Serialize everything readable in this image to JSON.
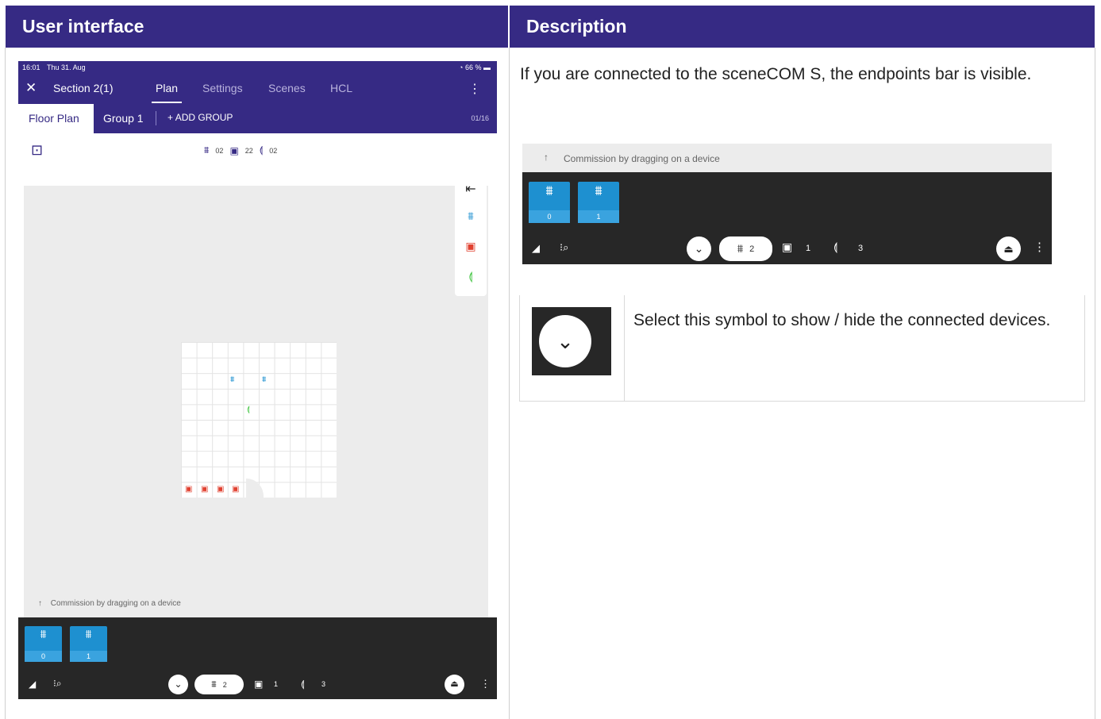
{
  "headers": {
    "left": "User interface",
    "right": "Description"
  },
  "tablet": {
    "status": {
      "time": "16:01",
      "date": "Thu 31. Aug",
      "battery": "66 %"
    },
    "appbar": {
      "close_icon": "close-icon",
      "section": "Section 2(1)",
      "tabs": [
        "Plan",
        "Settings",
        "Scenes",
        "HCL"
      ],
      "active_tab": "Plan"
    },
    "subbar": {
      "floor_plan": "Floor Plan",
      "group": "Group 1",
      "add_group": "ADD GROUP",
      "count": "01/16"
    },
    "counts": {
      "luminaires": "02",
      "sensors": "22",
      "switches": "02"
    },
    "commission_hint": "Commission by dragging on a device",
    "tiles": [
      "0",
      "1"
    ],
    "bottom_counts": {
      "luminaires": "2",
      "sensors": "1",
      "switches": "3"
    }
  },
  "right": {
    "description": "If you are connected to the sceneCOM S, the endpoints bar is visible.",
    "crop": {
      "commission_hint": "Commission by dragging on a device",
      "tiles": [
        "0",
        "1"
      ],
      "bottom_counts": {
        "luminaires": "2",
        "sensors": "1",
        "switches": "3"
      }
    },
    "symbol_text": "Select this symbol to show / hide the connected devices."
  },
  "colors": {
    "header": "#362a84",
    "accent_blue": "#1e90d0",
    "bar_dark": "#272727",
    "sensor_red": "#e0402f",
    "switch_green": "#3fc43f"
  }
}
